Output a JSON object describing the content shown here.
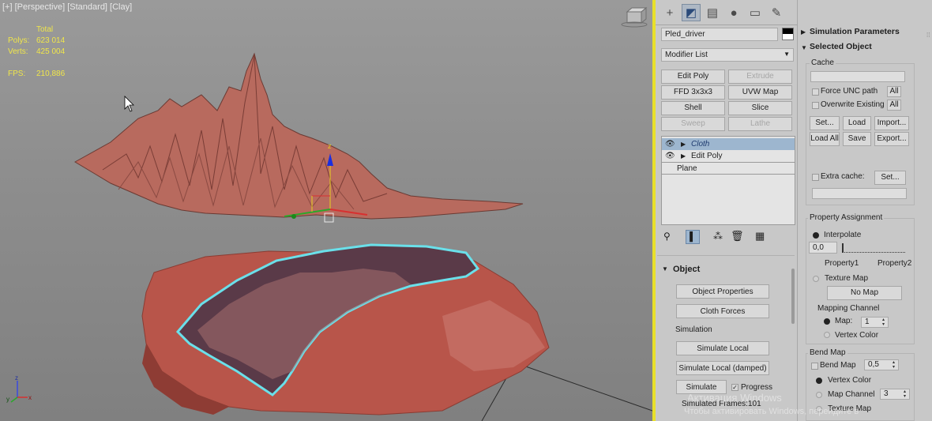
{
  "viewport": {
    "label": "[+] [Perspective] [Standard] [Clay]",
    "stats": {
      "header": "Total",
      "polys_label": "Polys:",
      "polys_value": "623 014",
      "verts_label": "Verts:",
      "verts_value": "425 004",
      "fps_label": "FPS:",
      "fps_value": "210,886"
    },
    "gizmo_axis": "z",
    "axis_tripod": {
      "z": "z",
      "y": "y",
      "x": "x"
    }
  },
  "command_panel": {
    "tabs": [
      "create-icon",
      "modify-icon",
      "hierarchy-icon",
      "motion-icon",
      "display-icon",
      "utilities-icon"
    ],
    "object_name": "Pled_driver",
    "modifier_list": "Modifier List",
    "modifier_buttons": [
      {
        "label": "Edit Poly",
        "enabled": true
      },
      {
        "label": "Extrude",
        "enabled": false
      },
      {
        "label": "FFD 3x3x3",
        "enabled": true
      },
      {
        "label": "UVW Map",
        "enabled": true
      },
      {
        "label": "Shell",
        "enabled": true
      },
      {
        "label": "Slice",
        "enabled": true
      },
      {
        "label": "Sweep",
        "enabled": false
      },
      {
        "label": "Lathe",
        "enabled": false
      }
    ],
    "stack": [
      "Cloth",
      "Edit Poly",
      "Plane"
    ],
    "object_rollout": {
      "title": "Object",
      "object_properties": "Object Properties",
      "cloth_forces": "Cloth Forces",
      "simulation_group": "Simulation",
      "simulate_local": "Simulate Local",
      "simulate_local_damped": "Simulate Local (damped)",
      "simulate": "Simulate",
      "progress_label": "Progress",
      "simulated_frames_label": "Simulated Frames:",
      "simulated_frames_value": "101"
    }
  },
  "right_panel": {
    "simulation_parameters": "Simulation Parameters",
    "selected_object": "Selected Object",
    "cache_label": "Cache",
    "force_unc": "Force UNC path",
    "overwrite": "Overwrite Existing",
    "all": "All",
    "set": "Set...",
    "load": "Load",
    "import": "Import...",
    "load_all": "Load All",
    "save": "Save",
    "export": "Export...",
    "extra_cache": "Extra cache:",
    "property_assignment": "Property Assignment",
    "interpolate": "Interpolate",
    "interpolate_value": "0,0",
    "property1": "Property1",
    "property2": "Property2",
    "texture_map": "Texture Map",
    "no_map": "No Map",
    "mapping_channel": "Mapping Channel",
    "map_label": "Map:",
    "map_value": "1",
    "vertex_color": "Vertex Color",
    "bend_map_title": "Bend Map",
    "bend_map": "Bend Map",
    "bend_value": "0,5",
    "bend_vertex_color": "Vertex Color",
    "map_channel": "Map Channel",
    "map_channel_value": "3",
    "bend_texture_map": "Texture Map"
  },
  "watermark": {
    "line1": "Активация Windows",
    "line2": "Чтобы активировать Windows, перейдите в"
  }
}
